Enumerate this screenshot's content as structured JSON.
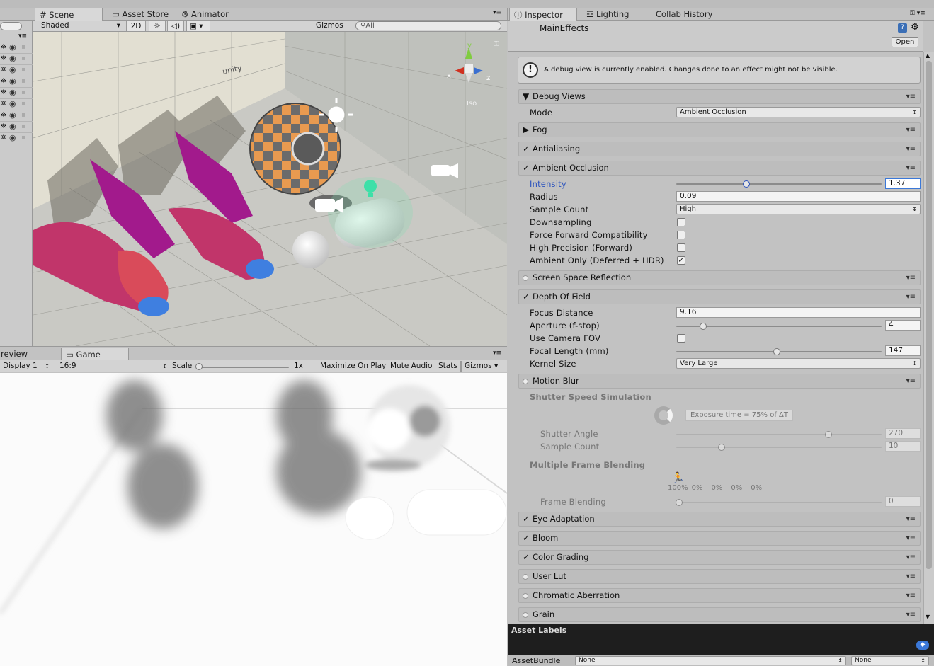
{
  "scene_tabs": {
    "scene": "Scene",
    "asset_store": "Asset Store",
    "animator": "Animator"
  },
  "scene_toolbar": {
    "shading": "Shaded",
    "mode_2d": "2D",
    "gizmos": "Gizmos",
    "search_placeholder": "All"
  },
  "scene_view": {
    "iso_label": "Iso",
    "gizmo_x": "x",
    "gizmo_y": "y",
    "gizmo_z": "z",
    "unity_logo": "unity"
  },
  "game_tabs": {
    "preview": "review",
    "game": "Game"
  },
  "game_toolbar": {
    "display": "Display 1",
    "aspect": "16:9",
    "scale_label": "Scale",
    "scale_value": "1x",
    "maximize": "Maximize On Play",
    "mute": "Mute Audio",
    "stats": "Stats",
    "gizmos": "Gizmos"
  },
  "inspector_tabs": {
    "inspector": "Inspector",
    "lighting": "Lighting",
    "collab": "Collab History"
  },
  "inspector": {
    "object_name": "MainEffects",
    "open_button": "Open",
    "debug_notice": "A debug view is currently enabled. Changes done to an effect might not be visible.",
    "sections": {
      "debug_views": "Debug Views",
      "fog": "Fog",
      "antialiasing": "Antialiasing",
      "ambient_occlusion": "Ambient Occlusion",
      "ssr": "Screen Space Reflection",
      "dof": "Depth Of Field",
      "motion_blur": "Motion Blur",
      "eye_adaptation": "Eye Adaptation",
      "bloom": "Bloom",
      "color_grading": "Color Grading",
      "user_lut": "User Lut",
      "chromatic": "Chromatic Aberration",
      "grain": "Grain"
    },
    "debug": {
      "mode_label": "Mode",
      "mode_value": "Ambient Occlusion"
    },
    "ao": {
      "intensity_label": "Intensity",
      "intensity_value": "1.37",
      "intensity_fraction": 0.34,
      "radius_label": "Radius",
      "radius_value": "0.09",
      "sample_label": "Sample Count",
      "sample_value": "High",
      "downsampling": "Downsampling",
      "force_forward": "Force Forward Compatibility",
      "high_precision": "High Precision (Forward)",
      "ambient_only": "Ambient Only (Deferred + HDR)"
    },
    "dof": {
      "focus_label": "Focus Distance",
      "focus_value": "9.16",
      "aperture_label": "Aperture (f-stop)",
      "aperture_value": "4",
      "aperture_fraction": 0.13,
      "camera_fov": "Use Camera FOV",
      "focal_label": "Focal Length (mm)",
      "focal_value": "147",
      "focal_fraction": 0.49,
      "kernel_label": "Kernel Size",
      "kernel_value": "Very Large"
    },
    "motion_blur": {
      "shutter_heading": "Shutter Speed Simulation",
      "exposure_text": "Exposure time = 75% of ΔT",
      "shutter_angle_label": "Shutter Angle",
      "shutter_angle_value": "270",
      "shutter_angle_fraction": 0.74,
      "sample_count_label": "Sample Count",
      "sample_count_value": "10",
      "sample_count_fraction": 0.22,
      "multi_heading": "Multiple Frame Blending",
      "blend_percents": [
        "100%",
        "0%",
        "0%",
        "0%",
        "0%"
      ],
      "frame_blending_label": "Frame Blending",
      "frame_blending_value": "0"
    }
  },
  "asset_labels": {
    "title": "Asset Labels",
    "bundle_label": "AssetBundle",
    "bundle_value": "None",
    "variant_value": "None"
  },
  "colors": {
    "panel": "#c2c2c2",
    "header": "#bdbdbd",
    "accent_blue": "#2a52be",
    "scene_bg": "#d9d9d2"
  }
}
